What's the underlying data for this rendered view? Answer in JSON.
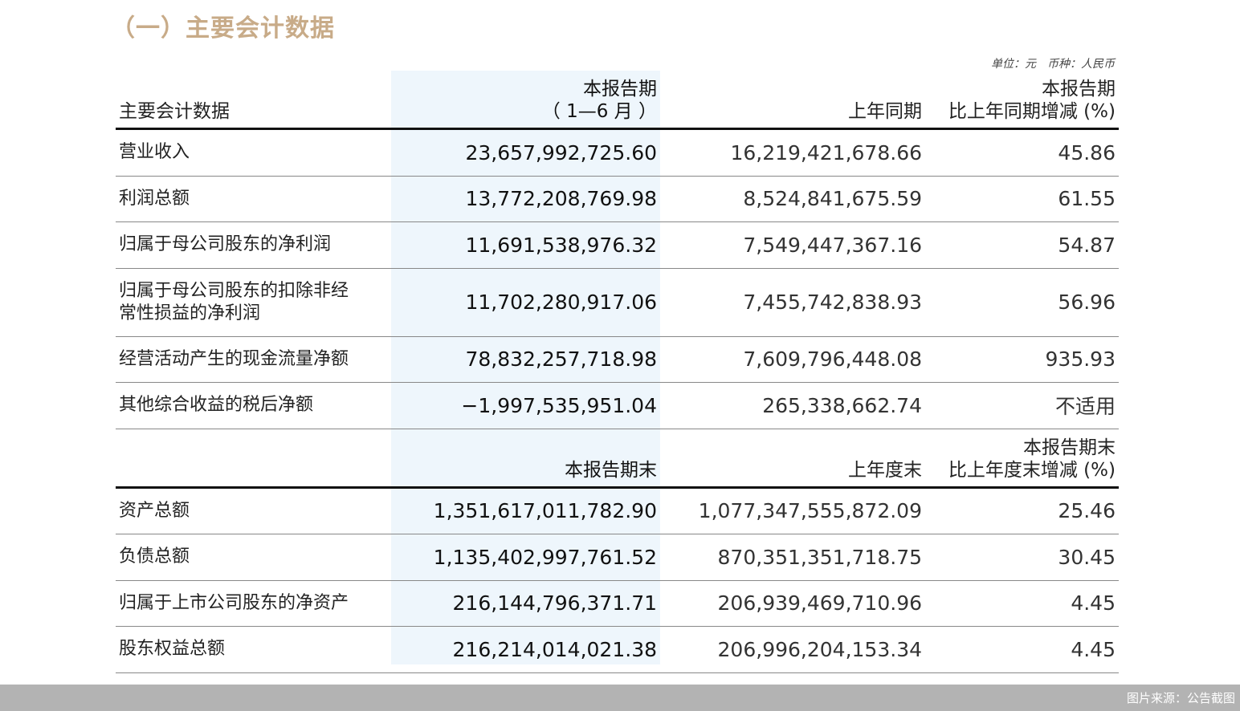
{
  "title": "（一）主要会计数据",
  "unit_note": "单位：元　币种：人民币",
  "header1": {
    "label": "主要会计数据",
    "current_l1": "本报告期",
    "current_l2": "（ 1—6 月 ）",
    "prior": "上年同期",
    "change_l1": "本报告期",
    "change_l2": "比上年同期增减 (%)"
  },
  "rows1": [
    {
      "label": "营业收入",
      "current": "23,657,992,725.60",
      "prior": "16,219,421,678.66",
      "change": "45.86"
    },
    {
      "label": "利润总额",
      "current": "13,772,208,769.98",
      "prior": "8,524,841,675.59",
      "change": "61.55"
    },
    {
      "label": "归属于母公司股东的净利润",
      "current": "11,691,538,976.32",
      "prior": "7,549,447,367.16",
      "change": "54.87"
    },
    {
      "label_l1": "归属于母公司股东的扣除非经",
      "label_l2": "常性损益的净利润",
      "current": "11,702,280,917.06",
      "prior": "7,455,742,838.93",
      "change": "56.96"
    },
    {
      "label": "经营活动产生的现金流量净额",
      "current": "78,832,257,718.98",
      "prior": "7,609,796,448.08",
      "change": "935.93"
    },
    {
      "label": "其他综合收益的税后净额",
      "current": "−1,997,535,951.04",
      "prior": "265,338,662.74",
      "change": "不适用"
    }
  ],
  "header2": {
    "current": "本报告期末",
    "prior": "上年度末",
    "change_l1": "本报告期末",
    "change_l2": "比上年度末增减 (%)"
  },
  "rows2": [
    {
      "label": "资产总额",
      "current": "1,351,617,011,782.90",
      "prior": "1,077,347,555,872.09",
      "change": "25.46"
    },
    {
      "label": "负债总额",
      "current": "1,135,402,997,761.52",
      "prior": "870,351,351,718.75",
      "change": "30.45"
    },
    {
      "label": "归属于上市公司股东的净资产",
      "current": "216,144,796,371.71",
      "prior": "206,939,469,710.96",
      "change": "4.45"
    },
    {
      "label": "股东权益总额",
      "current": "216,214,014,021.38",
      "prior": "206,996,204,153.34",
      "change": "4.45"
    }
  ],
  "source": "图片来源：公告截图",
  "colors": {
    "title": "#c8ab88",
    "highlight_column": "#eef6fc",
    "footer_bar": "#b3b3b3"
  }
}
